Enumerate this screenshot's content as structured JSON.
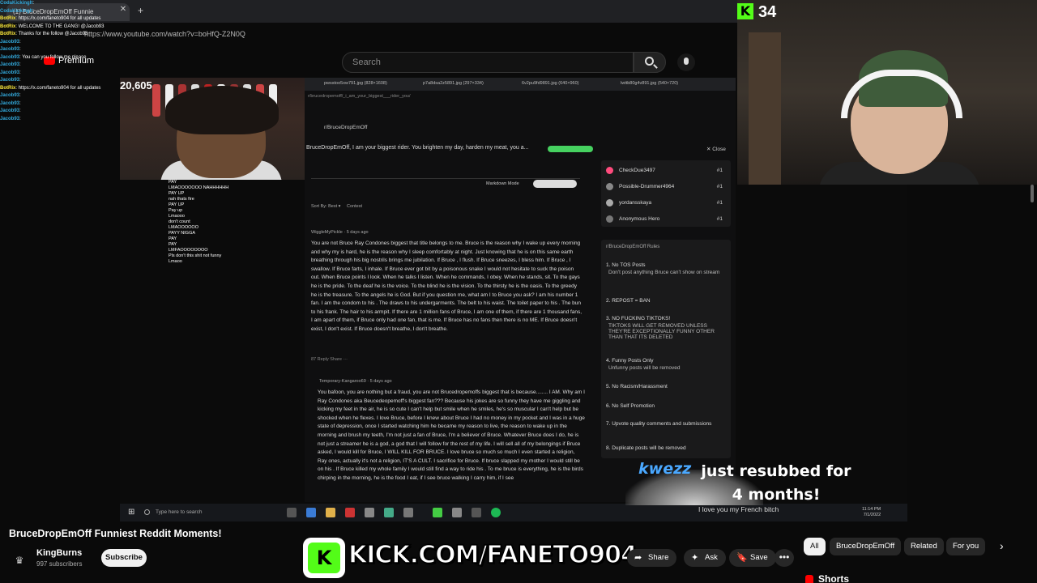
{
  "browser": {
    "tab_title": "(1) BruceDropEmOff Funnie",
    "url": "https://www.youtube.com/watch?v=boHfQ-Z2N0Q"
  },
  "youtube": {
    "logo_text": "Premium",
    "search_placeholder": "Search",
    "video_title": "BruceDropEmOff Funniest Reddit Moments!",
    "channel_name": "KingBurns",
    "channel_subs": "997 subscribers",
    "subscribe_label": "Subscribe",
    "actions": [
      {
        "label": "Share",
        "icon": "share-icon",
        "glyph": "➦"
      },
      {
        "label": "Ask",
        "icon": "sparkle-icon",
        "glyph": "✦"
      },
      {
        "label": "Save",
        "icon": "bookmark-icon",
        "glyph": "🔖"
      }
    ],
    "more_glyph": "•••",
    "chips": [
      "All",
      "BruceDropEmOff",
      "Related",
      "For you"
    ],
    "shorts_label": "Shorts"
  },
  "stream": {
    "viewer_count": "20,605",
    "kick_viewers": "34",
    "kick_banner": "KICK.COM/FANETO904",
    "alert_user": "kwezz",
    "alert_message": "just resubbed for 4 months!",
    "love_text": "I love you my French bitch",
    "taskbar_search": "Type here to search",
    "clock_time": "11:14 PM",
    "clock_date": "7/1/2022"
  },
  "chat": [
    {
      "user": "CodaKickingIt",
      "msg": "",
      "color": "c-cyan"
    },
    {
      "user": "CodaKickingIt",
      "msg": "",
      "color": "c-cyan"
    },
    {
      "user": "BotRix",
      "msg": "https://x.com/faneto904 for all updates",
      "color": "c-yellow"
    },
    {
      "user": "BotRix",
      "msg": "WELCOME TO THE GANG! @Jacob93",
      "color": "c-yellow"
    },
    {
      "user": "BotRix",
      "msg": "Thanks for the follow @Jacob93",
      "color": "c-yellow"
    },
    {
      "user": "Jacob93",
      "msg": "",
      "color": "c-cyan"
    },
    {
      "user": "Jacob93",
      "msg": "",
      "color": "c-cyan"
    },
    {
      "user": "Jacob93",
      "msg": "You can you follow me please",
      "color": "c-cyan"
    },
    {
      "user": "Jacob93",
      "msg": "",
      "color": "c-cyan"
    },
    {
      "user": "Jacob93",
      "msg": "",
      "color": "c-cyan"
    },
    {
      "user": "Jacob93",
      "msg": "",
      "color": "c-cyan"
    },
    {
      "user": "BotRix",
      "msg": "https://x.com/faneto904 for all updates",
      "color": "c-yellow"
    },
    {
      "user": "Jacob93",
      "msg": "",
      "color": "c-cyan"
    },
    {
      "user": "Jacob93",
      "msg": "",
      "color": "c-cyan"
    },
    {
      "user": "Jacob93",
      "msg": "",
      "color": "c-cyan"
    },
    {
      "user": "Jacob93",
      "msg": "",
      "color": "c-cyan"
    }
  ],
  "sub_chat": [
    "PAY",
    "LMAOOOOOOO NAHHHHHH",
    "PAY UP",
    "nah thats fire",
    "PAY UP",
    "Pay up",
    "Lmaooo",
    "don't count",
    "LMAOOOOOO",
    "PAYY NIGGA",
    "PAY",
    "PAY",
    "LMFAOOOOOOOO",
    "Pls don't this shit not funny",
    "Lmaoo"
  ],
  "reddit": {
    "tabs": [
      "pwsstoo5xw791.jpg (828×1608)",
      "p7a8dsa2z5891.jpg (297×334)",
      "6v2pu9fd9891.jpg (640×960)",
      "lwttb80g4v891.jpg (540×720)"
    ],
    "url": "r/brucedropemoff/_i_am_your_biggest___rider_you/",
    "sub_header": "r/BruceDropEmOff",
    "post_title": "BruceDropEmOff, I am your biggest      rider. You brighten my day, harden my meat, you a...",
    "close_label": "Close",
    "markdown_mode": "Markdown Mode",
    "sort_label": "Sort By: Best",
    "contest_label": "Contest",
    "comment1_user": "WiggleMyPickle · 5 days ago",
    "comment1": "You are not Bruce Ray Condones biggest       that title belongs to me. Bruce is the reason why I wake up every morning and why my       is hard, he is the reason why I sleep comfortably at night. Just knowing that he is on this same earth breathing through his big nostrils brings me jubilation. If Bruce       , I flush. If Bruce sneezes, I bless him. If Bruce       , I swallow. If Bruce farts, I inhale. If Bruce ever got bit by a poisonous snake I would not hesitate to suck the poison out. When Bruce points I look. When he talks I listen. When he commands, I obey. When he stands, sit. To the gays he is the pride. To the deaf he is the voice. To the blind he is the vision. To the thirsty he is the oasis. To the greedy he is the treasure. To the angels he is God. But if you question me, what am I to Bruce you ask? I am his number 1 fan. I am the condom to his       . The draws to his undergarments. The belt to his waist. The toilet paper to his       . The bun to his frank. The hair to his armpit. If there are 1 million fans of Bruce, I am one of them, if there are 1 thousand fans, I am apart of them, if Bruce only had one fan, that is me. If Bruce has no fans then there is no ME. If Bruce doesn't exist, I don't exist. If Bruce doesn't breathe, I don't breathe.",
    "comment1_actions": "87   Reply   Share   ···",
    "comment2_user": "Temporary-Kangaroo69 · 5 days ago",
    "comment2": "You       bafoon, you are nothing but a fraud, you are not Brucedropemoffs biggest       that is because........ I AM. Why am I Ray Condones aka Beucedeopemoff's biggest fan??? Because his jokes are so funny they have me giggling and kicking my feet in the air, he is so cute I can't help but smile when he smiles, he's so muscular I can't help but be shocked when he flexes. I love Bruce, before I knew about Bruce I had no money in my pocket and I was in a huge state of depression, once I started watching him he became my reason to live, the reason to wake up in the morning and brush my teeth, I'm not just a fan of Bruce, I'm a believer of Bruce. Whatever Bruce does I do, he is not just a streamer he is a god, a god that I will follow for the rest of my life. I will sell all of my belongings if Bruce asked, I would kill for Bruce, I WILL KILL FOR BRUCE. I love bruce so much so much I even started a religion, Ray       ones, actually it's not a religion, IT'S A       CULT. I sacrifice for Bruce. If bruce slapped my mother I would still be on his       . If Bruce killed my whole family I would still find a way to ride his       . To me bruce is everything, he is the birds chirping in the morning, he is the food I eat, if I see bruce walking I carry him, if I see",
    "leaderboard": [
      {
        "name": "CheckDue3497",
        "rank": "#1",
        "color": "#ff4b7d"
      },
      {
        "name": "Possible-Drummer4964",
        "rank": "#1",
        "color": "#888888"
      },
      {
        "name": "yordansskaya",
        "rank": "#1",
        "color": "#aaaaaa"
      },
      {
        "name": "Anonymous Hero",
        "rank": "#1",
        "color": "#777777"
      }
    ],
    "rules_title": "r/BruceDropEmOff Rules",
    "rules": [
      {
        "title": "1. No TOS Posts",
        "desc": "Don't post anything Bruce can't show on stream"
      },
      {
        "title": "2. REPOST = BAN",
        "desc": ""
      },
      {
        "title": "3. NO FUCKING TIKTOKS!",
        "desc": "TIKTOKS WILL GET REMOVED UNLESS THEY'RE EXCEPTIONALLY FUNNY OTHER THAN THAT ITS DELETED"
      },
      {
        "title": "4. Funny Posts Only",
        "desc": "Unfunny posts will be removed"
      },
      {
        "title": "5. No Racism/Harassment",
        "desc": ""
      },
      {
        "title": "6. No Self Promotion",
        "desc": ""
      },
      {
        "title": "7. Upvote quality comments and submissions",
        "desc": ""
      },
      {
        "title": "8. Duplicate posts will be removed",
        "desc": ""
      }
    ]
  }
}
